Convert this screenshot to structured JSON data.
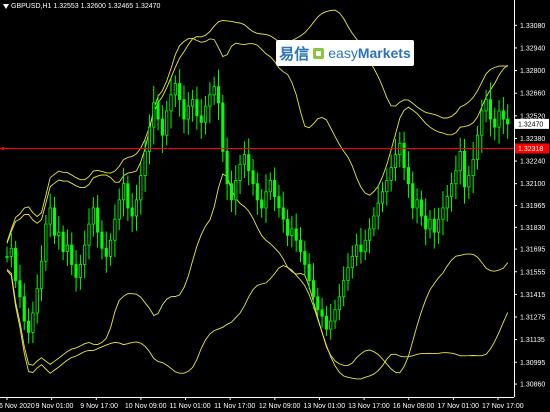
{
  "header": {
    "symbol_info": "GBPUSD,H1  1.32553 1.32600 1.32465 1.32470"
  },
  "logo": {
    "text_cn": "易信",
    "text_easy": "easy",
    "text_markets": "Markets",
    "color": "#2a73b8",
    "mark_color": "#8bc53f"
  },
  "chart_data": {
    "type": "candlestick",
    "symbol": "GBPUSD",
    "timeframe": "H1",
    "ohlc_last": {
      "open": 1.32553,
      "high": 1.326,
      "low": 1.32465,
      "close": 1.3247
    },
    "ylim": [
      1.3078,
      1.3315
    ],
    "y_ticks": [
      "1.33080",
      "1.32940",
      "1.32800",
      "1.32660",
      "1.32520",
      "1.32380",
      "1.32240",
      "1.32100",
      "1.31965",
      "1.31830",
      "1.31695",
      "1.31555",
      "1.31415",
      "1.31275",
      "1.31135",
      "1.30995",
      "1.30860"
    ],
    "x_ticks": [
      "6 Nov 2020",
      "9 Nov 01:00",
      "9 Nov 17:00",
      "10 Nov 09:00",
      "11 Nov 01:00",
      "11 Nov 17:00",
      "12 Nov 09:00",
      "13 Nov 01:00",
      "13 Nov 17:00",
      "16 Nov 09:00",
      "17 Nov 01:00",
      "17 Nov 17:00"
    ],
    "current_price_label": "1.32470",
    "red_line_label": "1.32318",
    "red_line_value": 1.32318,
    "colors": {
      "candle": "#00ff00",
      "bands": "#e8e84a",
      "red_line": "#ff0000",
      "axis": "#ffffff",
      "background": "#000000"
    },
    "indicator": "Bollinger Bands (two sets)",
    "series_closes": [
      1.3165,
      1.317,
      1.315,
      1.314,
      1.3125,
      1.3118,
      1.313,
      1.3145,
      1.3162,
      1.3185,
      1.3195,
      1.3178,
      1.318,
      1.3168,
      1.3172,
      1.316,
      1.3152,
      1.316,
      1.3172,
      1.3185,
      1.3195,
      1.318,
      1.317,
      1.3165,
      1.3175,
      1.3188,
      1.32,
      1.321,
      1.3195,
      1.319,
      1.32,
      1.3215,
      1.323,
      1.3245,
      1.326,
      1.325,
      1.324,
      1.3255,
      1.3265,
      1.3272,
      1.3262,
      1.325,
      1.3258,
      1.3262,
      1.3252,
      1.3248,
      1.3258,
      1.3265,
      1.327,
      1.326,
      1.323,
      1.321,
      1.32,
      1.3212,
      1.3222,
      1.3228,
      1.3218,
      1.321,
      1.32,
      1.3195,
      1.3205,
      1.3212,
      1.3202,
      1.3195,
      1.3188,
      1.3178,
      1.3182,
      1.3175,
      1.3168,
      1.316,
      1.315,
      1.314,
      1.3132,
      1.3128,
      1.312,
      1.3125,
      1.3132,
      1.314,
      1.315,
      1.3158,
      1.3165,
      1.3172,
      1.3168,
      1.3175,
      1.3182,
      1.319,
      1.3198,
      1.3205,
      1.3212,
      1.322,
      1.3228,
      1.3235,
      1.322,
      1.321,
      1.3195,
      1.32,
      1.319,
      1.3182,
      1.3188,
      1.318,
      1.3188,
      1.3195,
      1.3202,
      1.321,
      1.3218,
      1.323,
      1.3208,
      1.3215,
      1.3225,
      1.324,
      1.3255,
      1.3262,
      1.325,
      1.3245,
      1.3255,
      1.325,
      1.3247
    ]
  }
}
